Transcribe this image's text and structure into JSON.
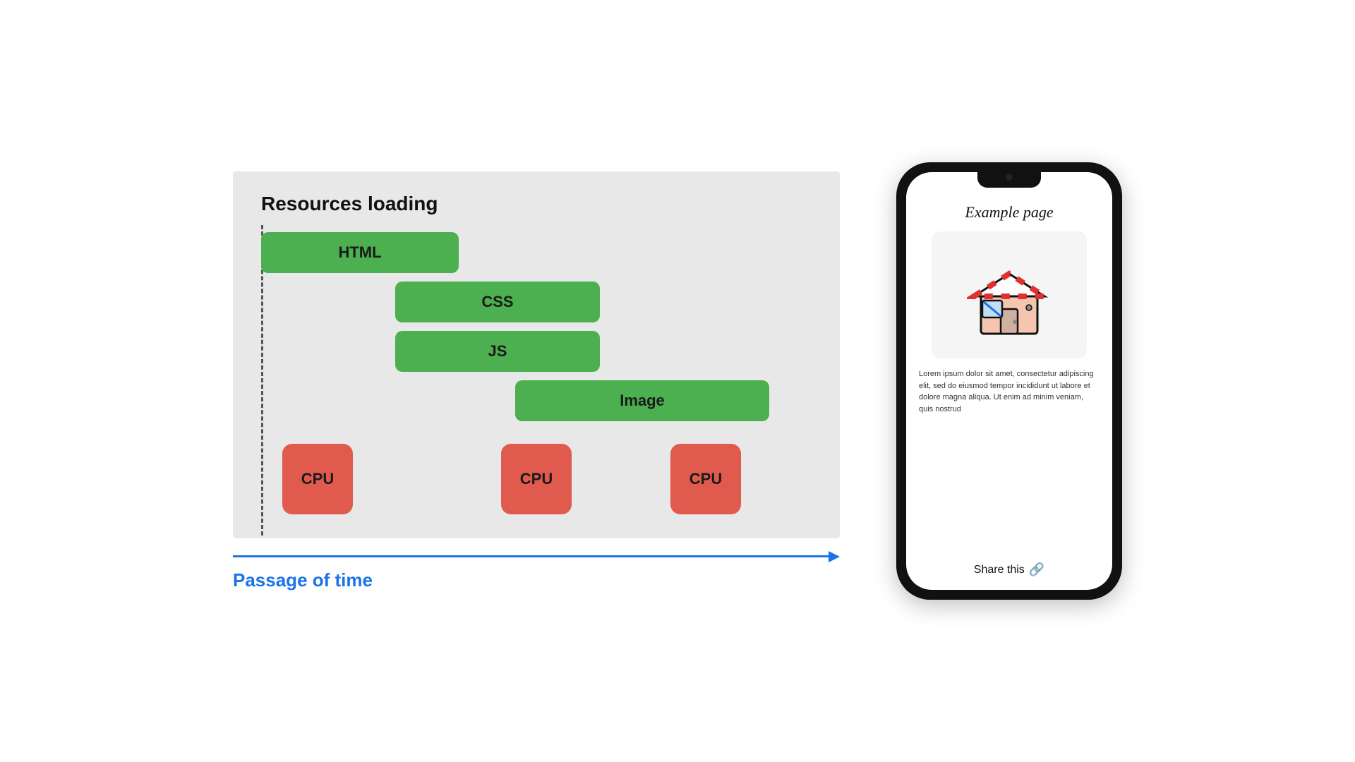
{
  "diagram": {
    "title": "Resources loading",
    "bars": [
      {
        "id": "html",
        "label": "HTML"
      },
      {
        "id": "css",
        "label": "CSS"
      },
      {
        "id": "js",
        "label": "JS"
      },
      {
        "id": "image",
        "label": "Image"
      }
    ],
    "cpu_boxes": [
      {
        "id": "cpu1",
        "label": "CPU"
      },
      {
        "id": "cpu2",
        "label": "CPU"
      },
      {
        "id": "cpu3",
        "label": "CPU"
      }
    ],
    "time_label": "Passage of time"
  },
  "phone": {
    "title": "Example page",
    "body_text": "Lorem ipsum dolor sit amet, consectetur adipiscing elit, sed do eiusmod tempor incididunt ut labore et dolore magna aliqua. Ut enim ad minim veniam, quis nostrud",
    "share_label": "Share this"
  },
  "colors": {
    "green": "#4caf50",
    "red": "#e05a4e",
    "blue": "#1a73e8",
    "diagram_bg": "#e8e8e8"
  }
}
